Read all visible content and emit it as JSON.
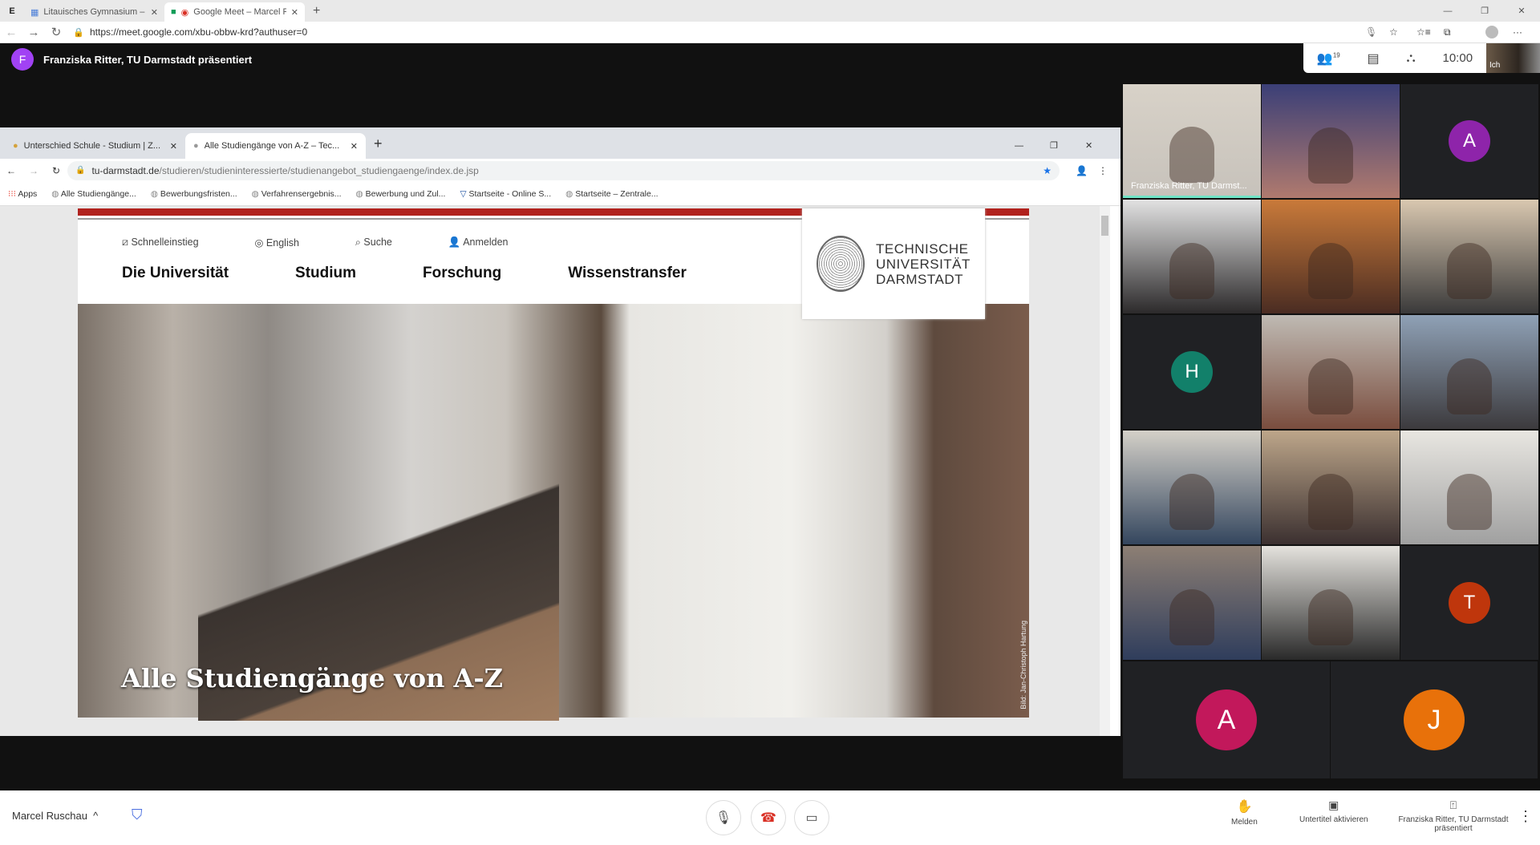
{
  "browser": {
    "tabs": [
      {
        "label": "Litauisches Gymnasium – Kalender",
        "active": false
      },
      {
        "label": "Google Meet – Marcel Ruschau",
        "active": true
      }
    ],
    "url": "https://meet.google.com/xbu-obbw-krd?authuser=0"
  },
  "meet": {
    "presenter_initial": "F",
    "presenter_text": "Franziska Ritter, TU Darmstadt präsentiert",
    "participants_count": "19",
    "time": "10:00",
    "self_label": "Ich",
    "tiles": [
      {
        "type": "video",
        "name": "Franziska Ritter, TU Darmst...",
        "colors": [
          "#d8d2c8",
          "#c7c2bb"
        ]
      },
      {
        "type": "video",
        "name": "",
        "colors": [
          "#3b3f77",
          "#b07a6e"
        ]
      },
      {
        "type": "avatar",
        "initial": "A",
        "color": "#8e24aa"
      },
      {
        "type": "video",
        "name": "",
        "colors": [
          "#e2e2e2",
          "#2c2a2b"
        ]
      },
      {
        "type": "video",
        "name": "",
        "colors": [
          "#c97a3a",
          "#4a2c22"
        ]
      },
      {
        "type": "video",
        "name": "",
        "colors": [
          "#d9c8b0",
          "#3a3a3a"
        ]
      },
      {
        "type": "avatar",
        "initial": "H",
        "color": "#12806a"
      },
      {
        "type": "video",
        "name": "",
        "colors": [
          "#bfbab3",
          "#7a4d3e"
        ]
      },
      {
        "type": "video",
        "name": "",
        "colors": [
          "#8fa1b6",
          "#3c3a3d"
        ]
      },
      {
        "type": "video",
        "name": "",
        "colors": [
          "#d4d0c8",
          "#34465e"
        ]
      },
      {
        "type": "video",
        "name": "",
        "colors": [
          "#bda68a",
          "#3b3030"
        ]
      },
      {
        "type": "video",
        "name": "",
        "colors": [
          "#e8e6e1",
          "#a0a0a0"
        ]
      },
      {
        "type": "video",
        "name": "",
        "colors": [
          "#8d7f74",
          "#2f3d5c"
        ]
      },
      {
        "type": "video",
        "name": "",
        "colors": [
          "#e4e2dd",
          "#2a2a2a"
        ]
      },
      {
        "type": "avatar",
        "initial": "T",
        "color": "#bf360c"
      }
    ],
    "large_avatars": [
      {
        "initial": "A",
        "color": "#c2185b"
      },
      {
        "initial": "J",
        "color": "#e8710a"
      }
    ],
    "user_name": "Marcel Ruschau",
    "actions": {
      "raise_hand": "Melden",
      "captions": "Untertitel aktivieren",
      "presenting": "Franziska Ritter, TU Darmstadt präsentiert"
    }
  },
  "shared": {
    "tabs": [
      {
        "label": "Unterschied Schule - Studium | Z...",
        "active": false
      },
      {
        "label": "Alle Studiengänge von A-Z – Tec...",
        "active": true
      }
    ],
    "url_host": "tu-darmstadt.de",
    "url_path": "/studieren/studieninteressierte/studienangebot_studiengaenge/index.de.jsp",
    "bookmarks": [
      "Apps",
      "Alle Studiengänge...",
      "Bewerbungsfristen...",
      "Verfahrensergebnis...",
      "Bewerbung und Zul...",
      "Startseite - Online S...",
      "Startseite – Zentrale..."
    ],
    "site": {
      "meta_links": [
        "Schnelleinstieg",
        "English",
        "Suche",
        "Anmelden"
      ],
      "nav": [
        "Die Universität",
        "Studium",
        "Forschung",
        "Wissenstransfer"
      ],
      "logo_lines": [
        "TECHNISCHE",
        "UNIVERSITÄT",
        "DARMSTADT"
      ],
      "hero_title": "Alle Studiengänge von A-Z",
      "photo_credit": "Bild: Jan-Christoph Hartung",
      "brand_color": "#b1221e"
    }
  }
}
